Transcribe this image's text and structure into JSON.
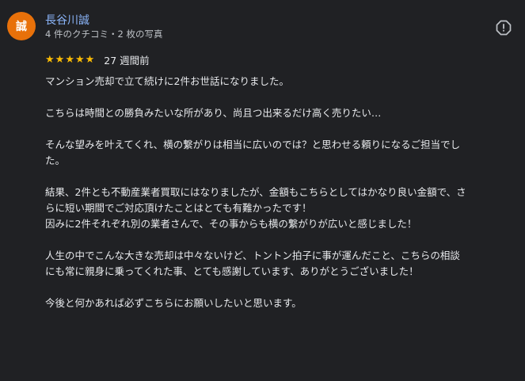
{
  "reviewer": {
    "avatar_initial": "誠",
    "name": "長谷川誠",
    "meta": "4 件のクチコミ・2 枚の写真"
  },
  "colors": {
    "avatar_bg": "#e8710a",
    "name_link": "#8ab4f8",
    "star": "#fbbc04",
    "background": "#202124"
  },
  "rating": {
    "stars": 5,
    "max_stars": 5,
    "time_ago": "27 週間前"
  },
  "report_icon": "report-flag-icon",
  "review": {
    "paragraphs": [
      {
        "lines": [
          "マンション売却で立て続けに2件お世話になりました。"
        ]
      },
      {
        "lines": [
          "こちらは時間との勝負みたいな所があり、尚且つ出来るだけ高く売りたい…"
        ]
      },
      {
        "lines": [
          "そんな望みを叶えてくれ、横の繋がりは相当に広いのでは？と思わせる頼りになるご担当でし",
          "た。"
        ]
      },
      {
        "lines": [
          "結果、2件とも不動産業者買取にはなりましたが、金額もこちらとしてはかなり良い金額で、さ",
          "らに短い期間でご対応頂けたことはとても有難かったです！",
          "因みに2件それぞれ別の業者さんで、その事からも横の繋がりが広いと感じました！"
        ]
      },
      {
        "lines": [
          "人生の中でこんな大きな売却は中々ないけど、トントン拍子に事が運んだこと、こちらの相談",
          "にも常に親身に乗ってくれた事、とても感謝しています、ありがとうございました！"
        ]
      },
      {
        "lines": [
          "今後と何かあれば必ずこちらにお願いしたいと思います。"
        ]
      }
    ]
  }
}
